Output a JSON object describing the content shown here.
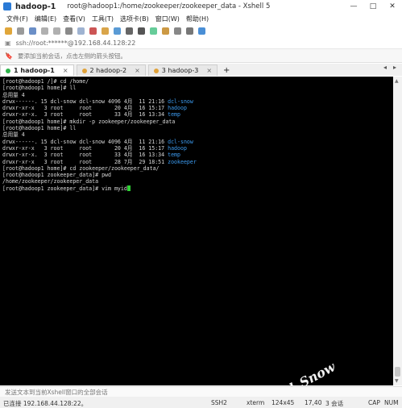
{
  "window": {
    "tab_name": "hadoop-1",
    "title": "root@hadoop1:/home/zookeeper/zookeeper_data - Xshell 5",
    "minimize": "—",
    "maximize": "□",
    "close": "✕"
  },
  "menu": [
    "文件(F)",
    "编辑(E)",
    "查看(V)",
    "工具(T)",
    "选项卡(B)",
    "窗口(W)",
    "帮助(H)"
  ],
  "address": {
    "text": "ssh://root:******@192.168.44.128:22"
  },
  "hint": {
    "text": "要添加当前会话，点击左侧的箭头按钮。"
  },
  "tabs": [
    {
      "index": "1",
      "label": "hadoop-1",
      "active": true,
      "close": "×"
    },
    {
      "index": "2",
      "label": "hadoop-2",
      "active": false,
      "close": "×"
    },
    {
      "index": "3",
      "label": "hadoop-3",
      "active": false,
      "close": "×"
    }
  ],
  "tab_add": "+",
  "terminal": {
    "lines": [
      {
        "p": "[root@hadoop1 /]# cd /home/"
      },
      {
        "p": "[root@hadoop1 home]# ll"
      },
      {
        "p": "总用量 4"
      },
      {
        "p": "drwx------. 15 dcl-snow dcl-snow 4096 4月  11 21:16 ",
        "b": "dcl-snow"
      },
      {
        "p": "drwxr-xr-x   3 root     root       20 4月  16 15:17 ",
        "b": "hadoop"
      },
      {
        "p": "drwxr-xr-x.  3 root     root       33 4月  16 13:34 ",
        "b": "temp"
      },
      {
        "p": "[root@hadoop1 home]# mkdir -p zookeeper/zookeeper_data"
      },
      {
        "p": "[root@hadoop1 home]# ll"
      },
      {
        "p": "总用量 4"
      },
      {
        "p": "drwx------. 15 dcl-snow dcl-snow 4096 4月  11 21:16 ",
        "b": "dcl-snow"
      },
      {
        "p": "drwxr-xr-x   3 root     root       20 4月  16 15:17 ",
        "b": "hadoop"
      },
      {
        "p": "drwxr-xr-x.  3 root     root       33 4月  16 13:34 ",
        "b": "temp"
      },
      {
        "p": "drwxr-xr-x   3 root     root       28 7月  29 18:51 ",
        "b": "zookeeper"
      },
      {
        "p": "[root@hadoop1 home]# cd zookeeper/zookeeper_data/"
      },
      {
        "p": "[root@hadoop1 zookeeper_data]# pwd"
      },
      {
        "p": "/home/zookeeper/zookeeper_data"
      },
      {
        "p": "[root@hadoop1 zookeeper_data]# vim myid",
        "cursor": true
      }
    ],
    "watermark": "Dcl_Snow"
  },
  "send": {
    "text": "发送文本到当前Xshell窗口的全部会话"
  },
  "status": {
    "connected": "已连接 192.168.44.128:22。",
    "protocol": "SSH2",
    "term": "xterm",
    "size": "124x45",
    "pos": "17,40",
    "sessions": "3 会话",
    "caps": "CAP",
    "num": "NUM"
  },
  "colors": {
    "terminal_bg": "#000000",
    "terminal_fg": "#d8d8d8",
    "dir_blue": "#3c9cf2",
    "cursor_green": "#2ed134",
    "active_tab_dot": "#2db34a"
  }
}
